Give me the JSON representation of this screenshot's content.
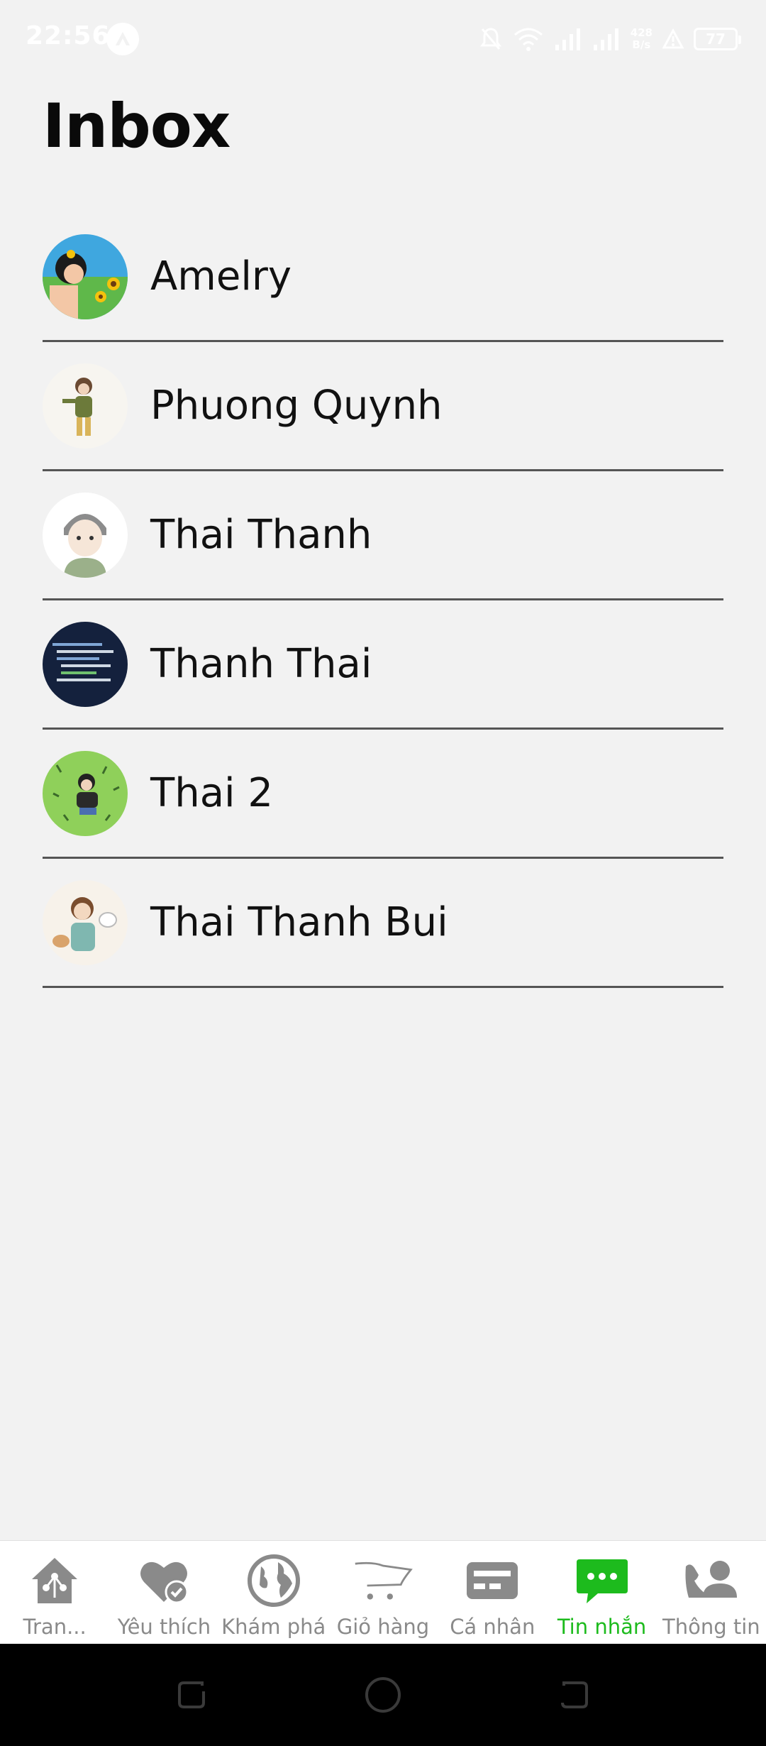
{
  "status_bar": {
    "time": "22:56",
    "speed_value": "428",
    "speed_unit": "B/s",
    "battery": "77"
  },
  "page": {
    "title": "Inbox"
  },
  "contacts": [
    {
      "name": "Amelry",
      "avatar": "sunflower-girl"
    },
    {
      "name": "Phuong Quynh",
      "avatar": "traveler-girl"
    },
    {
      "name": "Thai Thanh",
      "avatar": "anime-boy"
    },
    {
      "name": "Thanh Thai",
      "avatar": "code-screen"
    },
    {
      "name": "Thai 2",
      "avatar": "boy-on-grass"
    },
    {
      "name": "Thai Thanh Bui",
      "avatar": "boy-with-cats"
    }
  ],
  "bottom_nav": {
    "items": [
      {
        "label": "Tran...",
        "icon": "home-network-icon"
      },
      {
        "label": "Yêu thích",
        "icon": "heart-check-icon"
      },
      {
        "label": "Khám phá",
        "icon": "globe-icon"
      },
      {
        "label": "Giỏ hàng",
        "icon": "cart-icon"
      },
      {
        "label": "Cá nhân",
        "icon": "card-icon"
      },
      {
        "label": "Tin nhắn",
        "icon": "chat-icon"
      },
      {
        "label": "Thông tin",
        "icon": "phone-contact-icon"
      }
    ],
    "active_index": 5,
    "accent_color": "#1dbb1d",
    "inactive_color": "#8a8a8a"
  }
}
